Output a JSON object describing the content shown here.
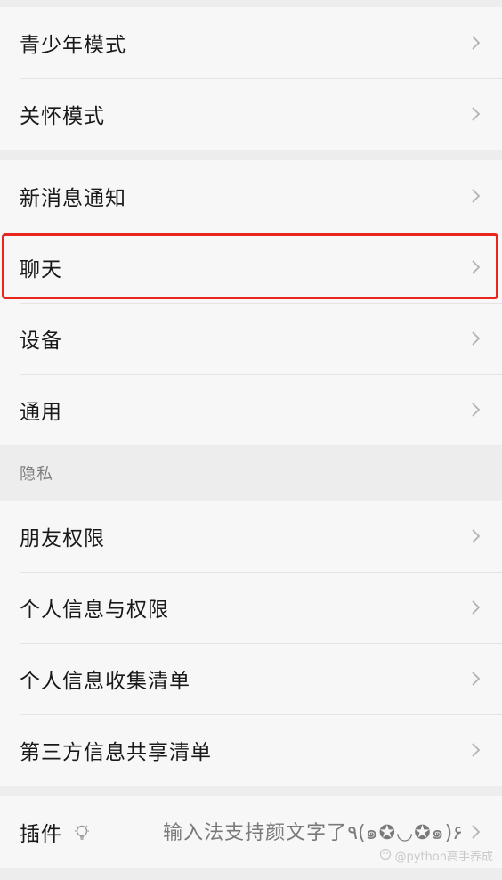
{
  "group1": {
    "items": [
      {
        "label": "青少年模式"
      },
      {
        "label": "关怀模式"
      }
    ]
  },
  "group2": {
    "items": [
      {
        "label": "新消息通知"
      },
      {
        "label": "聊天"
      },
      {
        "label": "设备"
      },
      {
        "label": "通用"
      }
    ]
  },
  "privacy_section": {
    "header": "隐私",
    "items": [
      {
        "label": "朋友权限"
      },
      {
        "label": "个人信息与权限"
      },
      {
        "label": "个人信息收集清单"
      },
      {
        "label": "第三方信息共享清单"
      }
    ]
  },
  "plugins": {
    "label": "插件",
    "hint": "输入法支持颜文字了٩(๑✪◡✪๑)۶",
    "icon": "lightbulb-icon"
  },
  "watermark": {
    "text": "@python高手养成",
    "icon": "watermark-logo-icon"
  },
  "colors": {
    "highlight_border": "#e8261f",
    "background": "#ededed",
    "row_background": "#f7f7f7"
  }
}
